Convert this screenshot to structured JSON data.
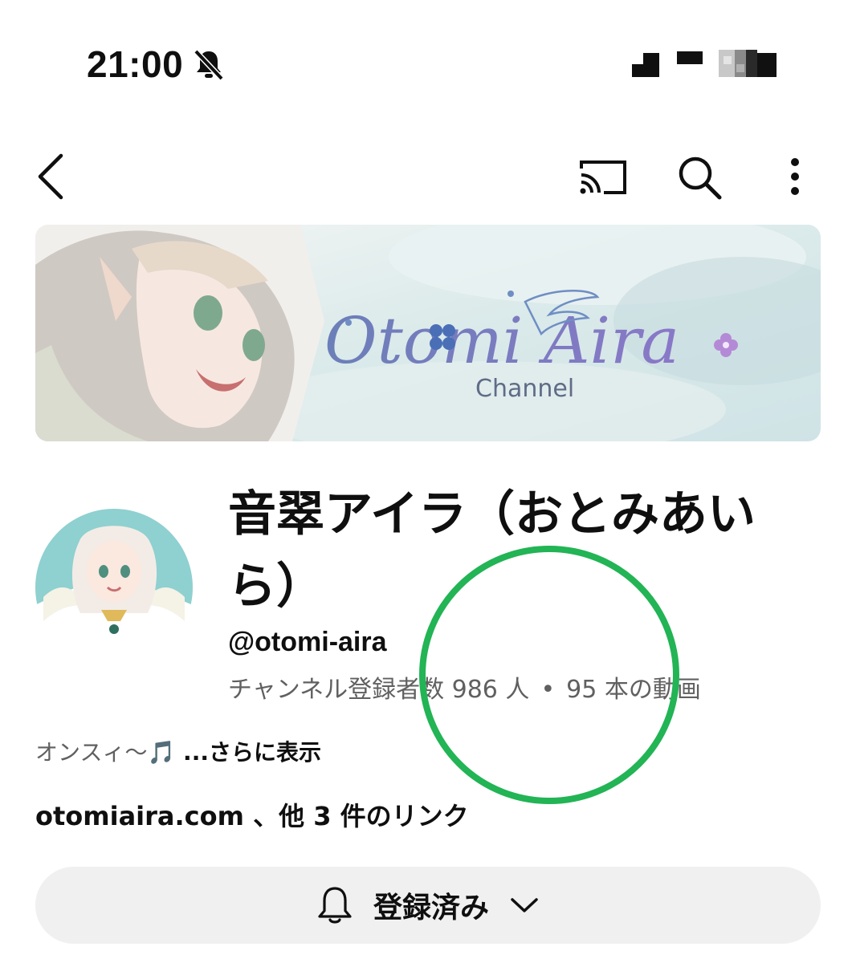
{
  "status_bar": {
    "time": "21:00",
    "bell_icon": "bell-off-icon",
    "signal_icon": "signal-icon"
  },
  "app_bar": {
    "back_icon": "back-arrow-icon",
    "cast_icon": "cast-icon",
    "search_icon": "search-icon",
    "more_icon": "more-vert-icon"
  },
  "banner": {
    "title": "Otomi Aira",
    "subtitle": "Channel"
  },
  "channel": {
    "name": "音翠アイラ（おとみあいら）",
    "handle": "@otomi-aira",
    "subscribers": "チャンネル登録者数 986 人",
    "separator": "•",
    "videos": "95 本の動画",
    "description": "オンスィ〜🎵",
    "more_label": " ...さらに表示",
    "links": "otomiaira.com 、他 3 件のリンク"
  },
  "subscribe_button": {
    "label": "登録済み",
    "bell_icon": "bell-icon",
    "chevron_icon": "chevron-down-icon"
  },
  "colors": {
    "text_primary": "#0f0f0f",
    "text_secondary": "#606060",
    "button_bg": "#f0f0f0",
    "highlight_ring": "#22b455"
  }
}
